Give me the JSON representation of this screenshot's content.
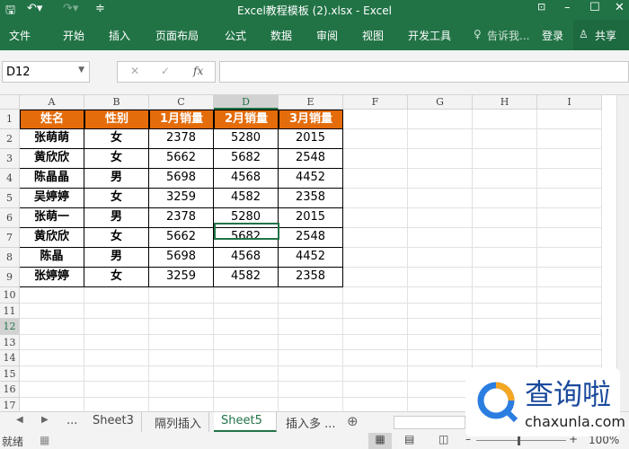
{
  "title": "Excel教程模板 (2).xlsx - Excel",
  "ribbon_tabs": [
    "文件",
    "开始",
    "插入",
    "页面布局",
    "公式",
    "数据",
    "审阅",
    "视图",
    "开发工具"
  ],
  "tell_me": "告诉我...",
  "login": "登录",
  "share": "共享",
  "name_box": "D12",
  "fx": "fx",
  "columns": [
    "A",
    "B",
    "C",
    "D",
    "E",
    "F",
    "G",
    "H",
    "I"
  ],
  "rows": [
    "1",
    "2",
    "3",
    "4",
    "5",
    "6",
    "7",
    "8",
    "9",
    "10",
    "11",
    "12",
    "13",
    "14",
    "15",
    "16",
    "17"
  ],
  "table": {
    "headers": [
      "姓名",
      "性别",
      "1月销量",
      "2月销量",
      "3月销量"
    ],
    "data": [
      [
        "张萌萌",
        "女",
        "2378",
        "5280",
        "2015"
      ],
      [
        "黄欣欣",
        "女",
        "5662",
        "5682",
        "2548"
      ],
      [
        "陈晶晶",
        "男",
        "5698",
        "4568",
        "4452"
      ],
      [
        "吴婷婷",
        "女",
        "3259",
        "4582",
        "2358"
      ],
      [
        "张萌一",
        "男",
        "2378",
        "5280",
        "2015"
      ],
      [
        "黄欣欣",
        "女",
        "5662",
        "5682",
        "2548"
      ],
      [
        "陈晶",
        "男",
        "5698",
        "4568",
        "4452"
      ],
      [
        "张婷婷",
        "女",
        "3259",
        "4582",
        "2358"
      ]
    ]
  },
  "sheet_tabs": [
    "...",
    "Sheet3",
    "隔列插入",
    "Sheet5",
    "插入多 ..."
  ],
  "active_sheet": "Sheet5",
  "status": {
    "ready": "就绪",
    "zoom": "100%"
  },
  "watermark": {
    "name": "查询啦",
    "url": "chaxunla.com"
  },
  "colors": {
    "accent": "#217346",
    "header_fill": "#e46c0a"
  }
}
